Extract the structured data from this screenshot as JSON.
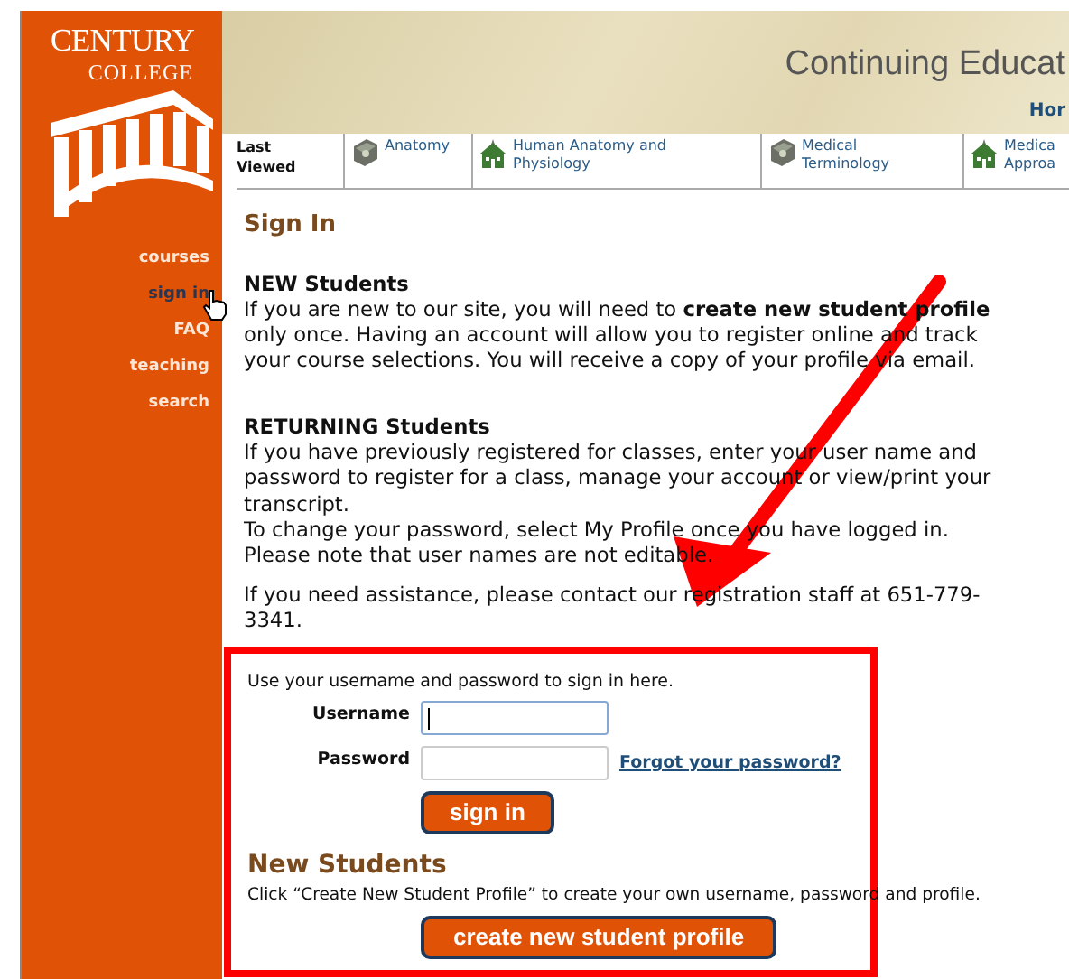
{
  "logo": {
    "line1": "CENTURY",
    "line2": "COLLEGE"
  },
  "sidebar": {
    "items": [
      {
        "label": "courses",
        "selected": false
      },
      {
        "label": "sign in",
        "selected": true
      },
      {
        "label": "FAQ",
        "selected": false
      },
      {
        "label": "teaching",
        "selected": false
      },
      {
        "label": "search",
        "selected": false
      }
    ]
  },
  "header": {
    "title": "Continuing Educat",
    "link": "Hor"
  },
  "recent": {
    "label": "Last Viewed",
    "items": [
      {
        "label": "Anatomy",
        "kind": "book"
      },
      {
        "label": "Human Anatomy and Physiology",
        "kind": "school"
      },
      {
        "label": "Medical Terminology",
        "kind": "book"
      },
      {
        "label": "Medica Approa",
        "kind": "school"
      }
    ]
  },
  "page_title": "Sign In",
  "sections": [
    {
      "heading": "NEW Students",
      "paragraphs": [
        "If you are new to our site, you will need to **create new student profile** only once. Having an account will allow you to register online and track your course selections. You will receive a copy of your profile via email."
      ]
    },
    {
      "heading": "RETURNING Students",
      "paragraphs": [
        "If you have previously registered for classes, enter your user name and password to register for a class, manage your account or view/print your transcript.",
        "To change your password, select My Profile once you have logged in.",
        "Please note that user names are not editable."
      ]
    }
  ],
  "assistance": "If you need assistance, please contact our registration staff at 651-779-3341.",
  "form": {
    "intro": "Use your username and password to sign in here.",
    "fields": [
      {
        "label": "Username",
        "focused": true
      },
      {
        "label": "Password",
        "focused": false,
        "link": "Forgot your password?"
      }
    ],
    "submit": "sign in",
    "new_heading": "New Students",
    "new_text": "Click “Create New Student Profile” to create your own username, password and profile.",
    "create_button": "create new student profile"
  }
}
